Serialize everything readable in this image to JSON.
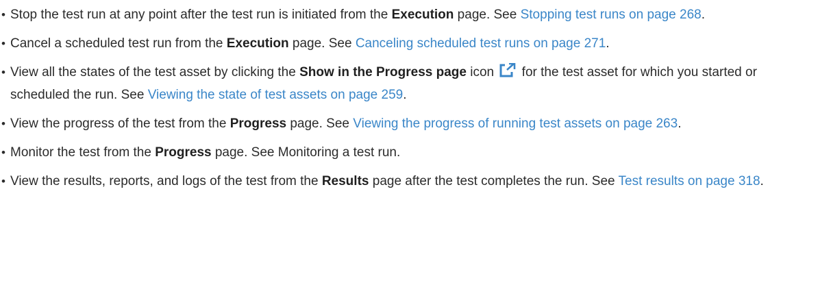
{
  "items": [
    {
      "t1": "Stop the test run at any point after the test run is initiated from the ",
      "b1": "Execution",
      "t2": " page. See ",
      "link": "Stopping test runs on page 268",
      "t3": "."
    },
    {
      "t1": "Cancel a scheduled test run from the ",
      "b1": "Execution",
      "t2": " page. See ",
      "link": "Canceling scheduled test runs on page 271",
      "t3": "."
    },
    {
      "t1": "View all the states of the test asset by clicking the ",
      "b1": "Show in the Progress page",
      "t2": " icon ",
      "icon": "open-in-new-window-icon",
      "t3": " for the test asset for which you started or scheduled the run. See ",
      "link": "Viewing the state of test assets on page 259",
      "t4": "."
    },
    {
      "t1": "View the progress of the test from the ",
      "b1": "Progress",
      "t2": " page. See ",
      "link": "Viewing the progress of running test assets on page 263",
      "t3": "."
    },
    {
      "t1": "Monitor the test from the ",
      "b1": "Progress",
      "t2": " page. See Monitoring a test run."
    },
    {
      "t1": "View the results, reports, and logs of the test from the ",
      "b1": "Results",
      "t2": " page after the test completes the run. See ",
      "link": "Test results on page 318",
      "t3": "."
    }
  ],
  "colors": {
    "link": "#3a86c8",
    "text": "#2b2b2b",
    "icon": "#3a86c8"
  }
}
